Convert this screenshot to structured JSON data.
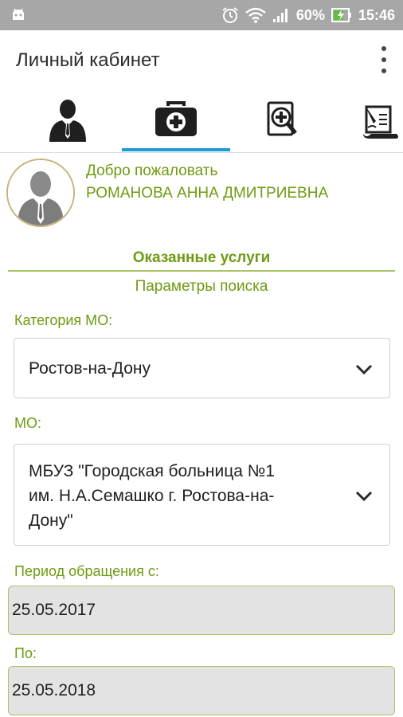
{
  "status_bar": {
    "battery": "60%",
    "time": "15:46",
    "icons": [
      "android-icon",
      "alarm-icon",
      "wifi-icon",
      "signal-icon",
      "battery-charging-icon"
    ]
  },
  "app_bar": {
    "title": "Личный кабинет",
    "menu_icon": "more-vertical-icon"
  },
  "tabs": [
    {
      "icon": "person-icon",
      "selected": false
    },
    {
      "icon": "medical-case-icon",
      "selected": true
    },
    {
      "icon": "medical-search-icon",
      "selected": false
    },
    {
      "icon": "document-sign-icon",
      "selected": false
    }
  ],
  "colors": {
    "accent_green": "#6e9b12",
    "tab_indicator": "#1e9bd6",
    "status_bar": "#a7a7a7"
  },
  "welcome": {
    "greeting": "Добро пожаловать",
    "user_name": "РОМАНОВА АННА ДМИТРИЕВНА"
  },
  "services": {
    "title": "Оказанные услуги",
    "search_params": "Параметры поиска"
  },
  "form": {
    "category_label": "Категория МО:",
    "category_value": "Ростов-на-Дону",
    "mo_label": "МО:",
    "mo_value_line1": "МБУЗ \"Городская больница №1",
    "mo_value_line2": "им. Н.А.Семашко г. Ростова-на-",
    "mo_value_line3": "Дону\"",
    "period_from_label": "Период обращения с:",
    "period_from_value": "25.05.2017",
    "period_to_label": "По:",
    "period_to_value": "25.05.2018"
  }
}
